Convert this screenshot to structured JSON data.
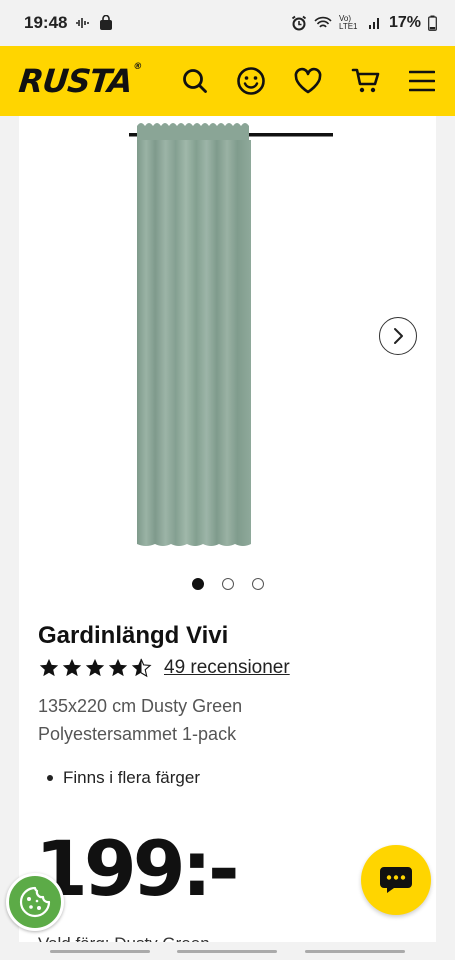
{
  "status_bar": {
    "time": "19:48",
    "network": "Vo) LTE1",
    "battery": "17%"
  },
  "header": {
    "logo": "RUSTA",
    "icons": [
      "search-icon",
      "smiley-icon",
      "heart-icon",
      "cart-icon",
      "menu-icon"
    ]
  },
  "product": {
    "title": "Gardinlängd Vivi",
    "rating": 4.5,
    "reviews_label": "49 recensioner",
    "variant_line1": "135x220 cm Dusty Green",
    "variant_line2": "Polyestersammet 1-pack",
    "bullet": "Finns i flera färger",
    "price": "199:-",
    "color_label": "Vald färg: Dusty Green",
    "image_count": 3,
    "image_active": 1
  },
  "colors": {
    "brand_yellow": "#ffd500",
    "curtain_green": "#8aa596",
    "cookie_green": "#5cab47"
  }
}
